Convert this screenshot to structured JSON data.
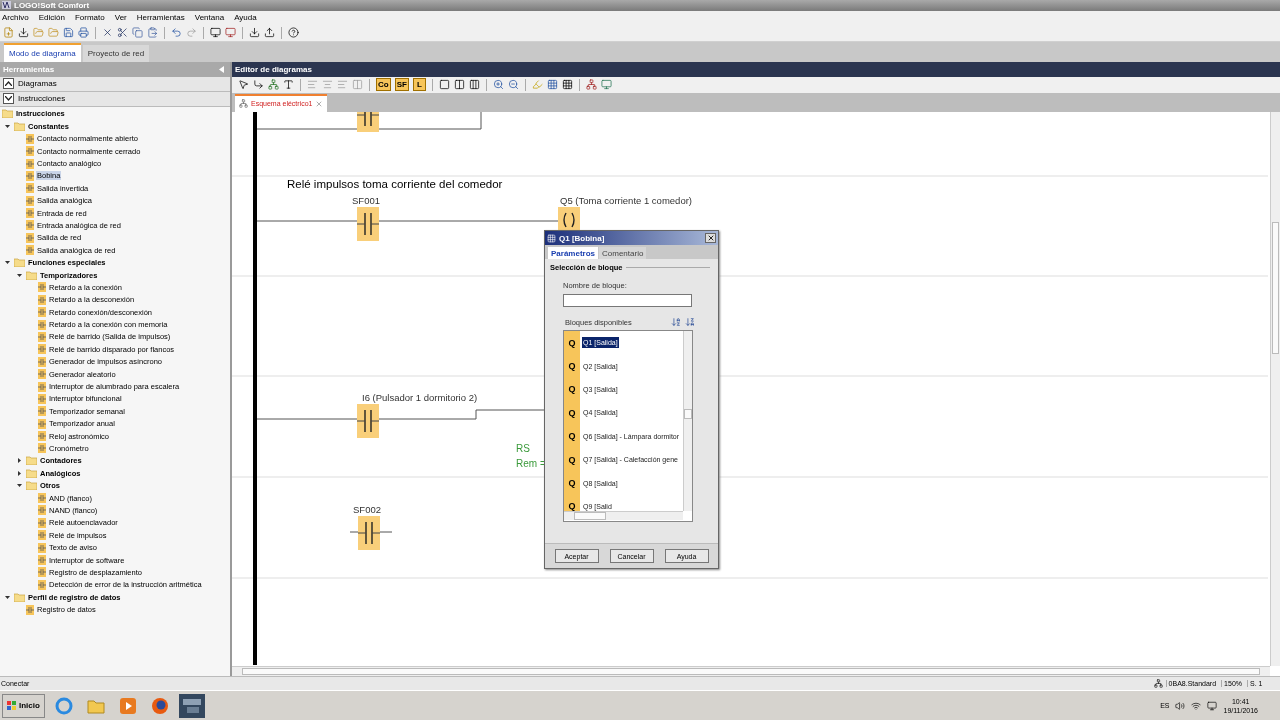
{
  "window": {
    "title": "LOGO!Soft Comfort"
  },
  "menu": [
    "Archivo",
    "Edición",
    "Formato",
    "Ver",
    "Herramientas",
    "Ventana",
    "Ayuda"
  ],
  "mode_tabs": [
    {
      "label": "Modo de diagrama",
      "selected": true
    },
    {
      "label": "Proyecto de red",
      "selected": false
    }
  ],
  "tools_panel": {
    "title": "Herramientas",
    "sections": [
      {
        "label": "Diagramas",
        "expanded": false
      },
      {
        "label": "Instrucciones",
        "expanded": true
      }
    ],
    "tree": {
      "label": "Instrucciones",
      "children": [
        {
          "kind": "folder",
          "label": "Constantes",
          "expanded": true,
          "selected": false,
          "children": [
            {
              "kind": "item",
              "label": "Contacto normalmente abierto",
              "selected": false
            },
            {
              "kind": "item",
              "label": "Contacto normalmente cerrado",
              "selected": false
            },
            {
              "kind": "item",
              "label": "Contacto analógico",
              "selected": false
            },
            {
              "kind": "item",
              "label": "Bobina",
              "selected": true
            },
            {
              "kind": "item",
              "label": "Salida invertida",
              "selected": false
            },
            {
              "kind": "item",
              "label": "Salida analógica",
              "selected": false
            },
            {
              "kind": "item",
              "label": "Entrada de red",
              "selected": false
            },
            {
              "kind": "item",
              "label": "Entrada analógica de red",
              "selected": false
            },
            {
              "kind": "item",
              "label": "Salida de red",
              "selected": false
            },
            {
              "kind": "item",
              "label": "Salida analógica de red",
              "selected": false
            }
          ]
        },
        {
          "kind": "folder",
          "label": "Funciones especiales",
          "expanded": true,
          "selected": false,
          "children": [
            {
              "kind": "folder",
              "label": "Temporizadores",
              "expanded": true,
              "selected": false,
              "children": [
                {
                  "kind": "item",
                  "label": "Retardo a la conexión",
                  "selected": false
                },
                {
                  "kind": "item",
                  "label": "Retardo a la desconexión",
                  "selected": false
                },
                {
                  "kind": "item",
                  "label": "Retardo conexión/desconexión",
                  "selected": false
                },
                {
                  "kind": "item",
                  "label": "Retardo a la conexión con memoria",
                  "selected": false
                },
                {
                  "kind": "item",
                  "label": "Relé de barrido (Salida de impulsos)",
                  "selected": false
                },
                {
                  "kind": "item",
                  "label": "Relé de barrido disparado por flancos",
                  "selected": false
                },
                {
                  "kind": "item",
                  "label": "Generador de impulsos asíncrono",
                  "selected": false
                },
                {
                  "kind": "item",
                  "label": "Generador aleatorio",
                  "selected": false
                },
                {
                  "kind": "item",
                  "label": "Interruptor de alumbrado para escalera",
                  "selected": false
                },
                {
                  "kind": "item",
                  "label": "Interruptor bifuncional",
                  "selected": false
                },
                {
                  "kind": "item",
                  "label": "Temporizador semanal",
                  "selected": false
                },
                {
                  "kind": "item",
                  "label": "Temporizador anual",
                  "selected": false
                },
                {
                  "kind": "item",
                  "label": "Reloj astronómico",
                  "selected": false
                },
                {
                  "kind": "item",
                  "label": "Cronómetro",
                  "selected": false
                }
              ]
            },
            {
              "kind": "folder",
              "label": "Contadores",
              "expanded": false,
              "selected": false
            },
            {
              "kind": "folder",
              "label": "Analógicos",
              "expanded": false,
              "selected": false
            },
            {
              "kind": "folder",
              "label": "Otros",
              "expanded": true,
              "selected": false,
              "children": [
                {
                  "kind": "item",
                  "label": "AND (flanco)",
                  "selected": false
                },
                {
                  "kind": "item",
                  "label": "NAND (flanco)",
                  "selected": false
                },
                {
                  "kind": "item",
                  "label": "Relé autoenclavador",
                  "selected": false
                },
                {
                  "kind": "item",
                  "label": "Relé de impulsos",
                  "selected": false
                },
                {
                  "kind": "item",
                  "label": "Texto de aviso",
                  "selected": false
                },
                {
                  "kind": "item",
                  "label": "Interruptor de software",
                  "selected": false
                },
                {
                  "kind": "item",
                  "label": "Registro de desplazamiento",
                  "selected": false
                },
                {
                  "kind": "item",
                  "label": "Detección de error de la instrucción aritmética",
                  "selected": false
                }
              ]
            }
          ]
        },
        {
          "kind": "folder",
          "label": "Perfil de registro de datos",
          "expanded": true,
          "selected": false,
          "children": [
            {
              "kind": "item",
              "label": "Registro de datos",
              "selected": false
            }
          ]
        }
      ]
    }
  },
  "editor": {
    "title": "Editor de diagramas",
    "constant_buttons": [
      "Co",
      "SF",
      "L"
    ],
    "tabs": [
      {
        "label": "Esquema eléctrico1",
        "selected": true
      }
    ],
    "comment": "Relé impulsos toma corriente del comedor",
    "blocks": [
      {
        "kind": "contact"
      },
      {
        "kind": "contact",
        "label": "SF001"
      },
      {
        "kind": "coil",
        "label": "Q5 (Toma corriente 1 comedor)"
      },
      {
        "kind": "contact",
        "label": "I6 (Pulsador 1 dormitorio 2)"
      },
      {
        "kind": "text",
        "label": "RS"
      },
      {
        "kind": "text",
        "label": "Rem ="
      },
      {
        "kind": "contact",
        "label": "SF002"
      }
    ]
  },
  "dialog": {
    "title": "Q1 [Bobina]",
    "tabs": [
      {
        "label": "Parámetros",
        "selected": true
      },
      {
        "label": "Comentario",
        "selected": false
      }
    ],
    "group": "Selección de bloque",
    "name_label": "Nombre de bloque:",
    "list_label": "Bloques disponibles",
    "blocks": [
      {
        "letter": "Q",
        "label": "Q1 [Salida]",
        "selected": true
      },
      {
        "letter": "Q",
        "label": "Q2 [Salida]",
        "selected": false
      },
      {
        "letter": "Q",
        "label": "Q3 [Salida]",
        "selected": false
      },
      {
        "letter": "Q",
        "label": "Q4 [Salida]",
        "selected": false
      },
      {
        "letter": "Q",
        "label": "Q6 [Salida] - Lámpara dormitor",
        "selected": false
      },
      {
        "letter": "Q",
        "label": "Q7 [Salida] - Calefacción gene",
        "selected": false
      },
      {
        "letter": "Q",
        "label": "Q8 [Salida]",
        "selected": false
      },
      {
        "letter": "Q",
        "label": "Q9 [Salid",
        "selected": false
      }
    ],
    "buttons": [
      "Aceptar",
      "Cancelar",
      "Ayuda"
    ]
  },
  "status_bar": {
    "text": "Conectar",
    "device": "0BA8.Standard",
    "zoom": "150%",
    "page": "S. 1"
  },
  "taskbar": {
    "start": "Inicio",
    "language": "ES",
    "time": "10:41",
    "date": "19/11/2016"
  }
}
